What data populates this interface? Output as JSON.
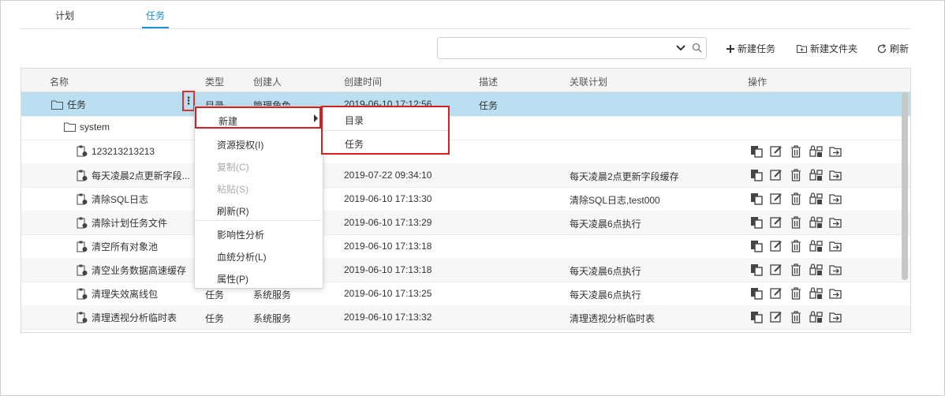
{
  "tabs": [
    {
      "label": "计划"
    },
    {
      "label": "任务"
    }
  ],
  "toolbar": {
    "search_value": "",
    "new_task": "新建任务",
    "new_folder": "新建文件夹",
    "refresh": "刷新"
  },
  "columns": {
    "name": "名称",
    "type": "类型",
    "creator": "创建人",
    "created_at": "创建时间",
    "desc": "描述",
    "plan": "关联计划",
    "actions": "操作"
  },
  "rows": [
    {
      "name": "任务",
      "type": "目录",
      "creator": "管理角色",
      "created_at": "2019-06-10 17:12:56",
      "desc": "任务",
      "plan": ""
    },
    {
      "name": "system",
      "type": "",
      "creator": "",
      "created_at": "",
      "desc": "",
      "plan": ""
    },
    {
      "name": "123213213213",
      "type": "",
      "creator": "",
      "created_at": "",
      "desc": "",
      "plan": ""
    },
    {
      "name": "每天凌晨2点更新字段...",
      "type": "",
      "creator": "",
      "created_at": "2019-07-22 09:34:10",
      "desc": "",
      "plan": "每天凌晨2点更新字段缓存"
    },
    {
      "name": "清除SQL日志",
      "type": "",
      "creator": "",
      "created_at": "2019-06-10 17:13:30",
      "desc": "",
      "plan": "清除SQL日志,test000"
    },
    {
      "name": "清除计划任务文件",
      "type": "",
      "creator": "",
      "created_at": "2019-06-10 17:13:29",
      "desc": "",
      "plan": "每天凌晨6点执行"
    },
    {
      "name": "清空所有对象池",
      "type": "",
      "creator": "",
      "created_at": "2019-06-10 17:13:18",
      "desc": "",
      "plan": ""
    },
    {
      "name": "清空业务数据高速缓存",
      "type": "",
      "creator": "",
      "created_at": "2019-06-10 17:13:18",
      "desc": "",
      "plan": "每天凌晨6点执行"
    },
    {
      "name": "清理失效离线包",
      "type": "任务",
      "creator": "系统服务",
      "created_at": "2019-06-10 17:13:25",
      "desc": "",
      "plan": "每天凌晨6点执行"
    },
    {
      "name": "清理透视分析临时表",
      "type": "任务",
      "creator": "系统服务",
      "created_at": "2019-06-10 17:13:32",
      "desc": "",
      "plan": "清理透视分析临时表"
    }
  ],
  "context_menu": {
    "new": "新建",
    "grant": "资源授权(I)",
    "copy": "复制(C)",
    "paste": "粘贴(S)",
    "refresh": "刷新(R)",
    "impact": "影响性分析",
    "lineage": "血统分析(L)",
    "props": "属性(P)"
  },
  "submenu": {
    "folder": "目录",
    "task": "任务"
  },
  "colors": {
    "accent": "#1f8fd6",
    "selected_row": "#b9dff0",
    "highlight_border": "#d42020"
  }
}
